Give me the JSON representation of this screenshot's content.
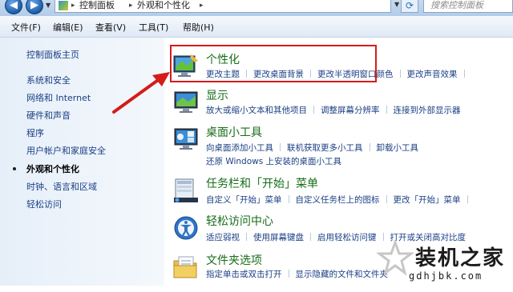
{
  "address_bar": {
    "breadcrumbs": [
      "控制面板",
      "外观和个性化"
    ],
    "search_placeholder": "搜索控制面板"
  },
  "menu": [
    "文件(F)",
    "编辑(E)",
    "查看(V)",
    "工具(T)",
    "帮助(H)"
  ],
  "sidebar": {
    "home": "控制面板主页",
    "items": [
      "系统和安全",
      "网络和 Internet",
      "硬件和声音",
      "程序",
      "用户帐户和家庭安全",
      "外观和个性化",
      "时钟、语言和区域",
      "轻松访问"
    ],
    "current_index": 5
  },
  "categories": [
    {
      "title": "个性化",
      "icon": "personalization-icon",
      "links": [
        "更改主题",
        "更改桌面背景",
        "更改半透明窗口颜色",
        "更改声音效果"
      ]
    },
    {
      "title": "显示",
      "icon": "display-icon",
      "links": [
        "放大或缩小文本和其他项目",
        "调整屏幕分辨率",
        "连接到外部显示器"
      ]
    },
    {
      "title": "桌面小工具",
      "icon": "gadgets-icon",
      "links": [
        "向桌面添加小工具",
        "联机获取更多小工具",
        "卸载小工具"
      ],
      "links2": [
        "还原 Windows 上安装的桌面小工具"
      ]
    },
    {
      "title": "任务栏和「开始」菜单",
      "icon": "taskbar-icon",
      "links": [
        "自定义「开始」菜单",
        "自定义任务栏上的图标",
        "更改「开始」菜单"
      ]
    },
    {
      "title": "轻松访问中心",
      "icon": "ease-of-access-icon",
      "links": [
        "适应弱视",
        "使用屏幕键盘",
        "启用轻松访问键",
        "打开或关闭高对比度"
      ]
    },
    {
      "title": "文件夹选项",
      "icon": "folder-options-icon",
      "links": [
        "指定单击或双击打开",
        "显示隐藏的文件和文件夹"
      ]
    }
  ],
  "watermark": {
    "text": "装机之家",
    "url": "gdhjbk.com"
  },
  "colors": {
    "category_title": "#176d1a",
    "link": "#1a3f84",
    "highlight": "#d51b1b"
  }
}
